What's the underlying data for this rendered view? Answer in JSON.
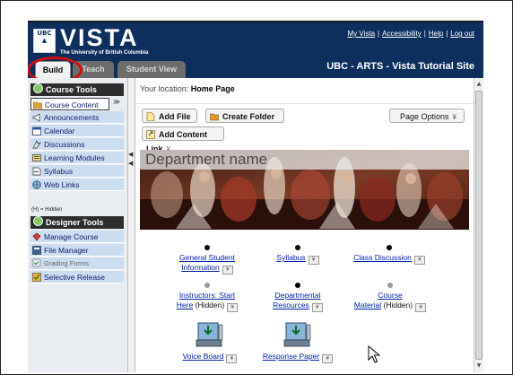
{
  "header": {
    "logo_text": "UBC",
    "brand": "VISTA",
    "subbrand": "The University of British Columbia",
    "links": [
      "My Vista",
      "Accessibility",
      "Help",
      "Log out"
    ],
    "link_separator": "|",
    "course_title": "UBC - ARTS - Vista Tutorial Site",
    "tabs": [
      {
        "label": "Build",
        "active": true
      },
      {
        "label": "Teach",
        "active": false
      },
      {
        "label": "Student View",
        "active": false
      }
    ],
    "highlight_color": "#d01010"
  },
  "sidebar": {
    "course_tools_title": "Course Tools",
    "course_tools": [
      {
        "label": "Course Content",
        "icon": "folder-icon",
        "active": true
      },
      {
        "label": "Announcements",
        "icon": "megaphone-icon"
      },
      {
        "label": "Calendar",
        "icon": "calendar-icon"
      },
      {
        "label": "Discussions",
        "icon": "discussion-icon"
      },
      {
        "label": "Learning Modules",
        "icon": "modules-icon"
      },
      {
        "label": "Syllabus",
        "icon": "syllabus-icon"
      },
      {
        "label": "Web Links",
        "icon": "web-links-icon"
      }
    ],
    "expand_glyph": "≫",
    "hidden_note": "(H) = Hidden",
    "designer_tools_title": "Designer Tools",
    "designer_tools": [
      {
        "label": "Manage Course",
        "icon": "manage-course-icon"
      },
      {
        "label": "File Manager",
        "icon": "file-manager-icon"
      },
      {
        "label": "Grading Forms",
        "icon": "grading-forms-icon"
      },
      {
        "label": "Selective Release",
        "icon": "selective-release-icon"
      }
    ]
  },
  "main": {
    "location_label": "Your location:",
    "location_value": "Home Page",
    "toolbar": {
      "add_file": "Add File",
      "create_folder": "Create Folder",
      "page_options": "Page Options",
      "add_content_link": "Add Content Link",
      "dropdown_glyph": "¥"
    },
    "banner_title": "Department name",
    "items": [
      {
        "lines": [
          "General Student",
          "Information"
        ],
        "hidden": false
      },
      {
        "lines": [
          "Syllabus"
        ],
        "hidden": false
      },
      {
        "lines": [
          "Class Discussion"
        ],
        "hidden": false
      },
      {
        "lines": [
          "Instructors: Start",
          "Here"
        ],
        "hidden": true
      },
      {
        "lines": [
          "Departmental",
          "Resources"
        ],
        "hidden": false
      },
      {
        "lines": [
          "Course",
          "Material"
        ],
        "hidden": true
      }
    ],
    "hidden_tag": "(Hidden)",
    "tools": [
      {
        "label": "Voice Board",
        "icon": "voice-board-icon"
      },
      {
        "label": "Response Paper",
        "icon": "response-paper-icon"
      }
    ]
  },
  "colors": {
    "header_bg": "#0d2f5d",
    "sidebar_bg": "#e9edf2",
    "nav_item_bg": "#cdddf0",
    "link": "#0022aa"
  }
}
